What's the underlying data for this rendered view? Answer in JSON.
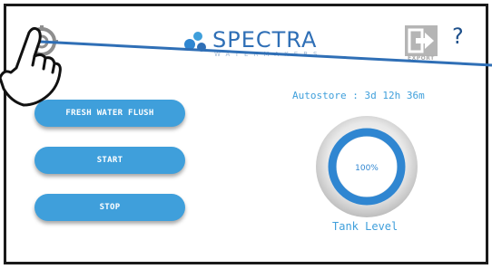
{
  "header": {
    "brand_name": "SPECTRA",
    "brand_subtitle": "WATERMAKERS",
    "export_label": "EXPORT",
    "help_label": "?"
  },
  "icons": {
    "settings": "gear-icon",
    "export": "export-icon",
    "help": "help-icon",
    "hand": "pointing-hand-icon"
  },
  "buttons": {
    "fresh_water_flush": "FRESH WATER FLUSH",
    "start": "START",
    "stop": "STOP"
  },
  "status": {
    "autostore": "Autostore : 3d 12h 36m"
  },
  "tank": {
    "level_text": "100%",
    "level_fraction": 1.0,
    "label": "Tank Level"
  },
  "colors": {
    "accent": "#3f9fdb",
    "brand": "#2f6fb6",
    "gauge_ring": "#2f86d1",
    "gauge_shell": "#d9d9d9"
  }
}
